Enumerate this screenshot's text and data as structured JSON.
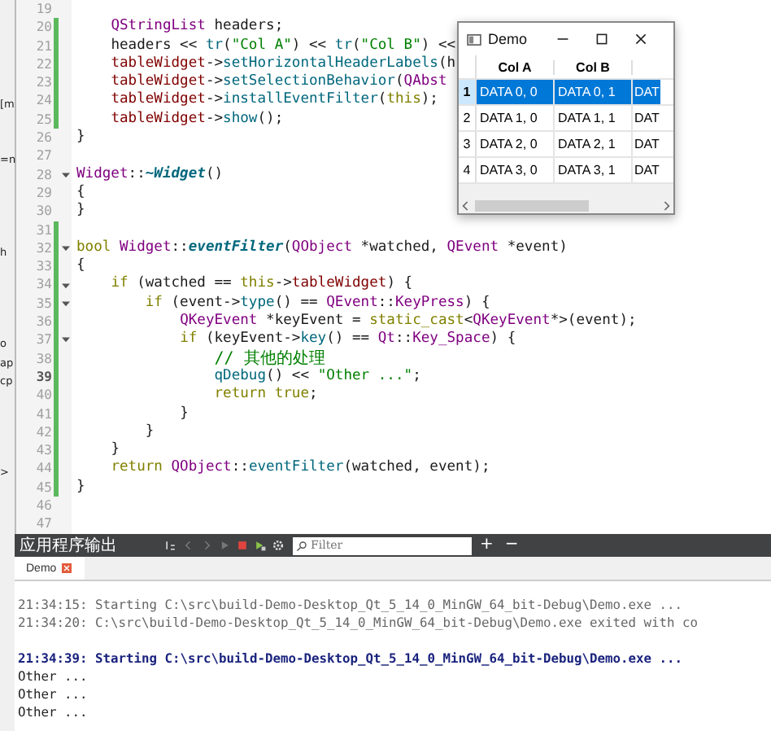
{
  "editor": {
    "lines": [
      {
        "number": "19",
        "changed": false,
        "fold": false,
        "current": false
      },
      {
        "number": "20",
        "changed": true,
        "fold": false,
        "current": false,
        "code": [
          {
            "kind": "type",
            "text": "    QStringList"
          },
          " headers;"
        ]
      },
      {
        "number": "21",
        "changed": true,
        "fold": false,
        "current": false,
        "code": [
          "    headers << ",
          {
            "kind": "fn",
            "text": "tr"
          },
          "(",
          {
            "kind": "str",
            "text": "\"Col A\""
          },
          ") << ",
          {
            "kind": "fn",
            "text": "tr"
          },
          "(",
          {
            "kind": "str",
            "text": "\"Col B\""
          },
          ") <<"
        ]
      },
      {
        "number": "22",
        "changed": true,
        "fold": false,
        "current": false,
        "code": [
          {
            "kind": "member",
            "text": "    tableWidget"
          },
          "->",
          {
            "kind": "fn",
            "text": "setHorizontalHeaderLabels"
          },
          "(h"
        ]
      },
      {
        "number": "23",
        "changed": true,
        "fold": false,
        "current": false,
        "code": [
          {
            "kind": "member",
            "text": "    tableWidget"
          },
          "->",
          {
            "kind": "fn",
            "text": "setSelectionBehavior"
          },
          "(",
          {
            "kind": "type",
            "text": "QAbst"
          }
        ]
      },
      {
        "number": "24",
        "changed": true,
        "fold": false,
        "current": false,
        "side": "[m",
        "code": [
          {
            "kind": "member",
            "text": "    tableWidget"
          },
          "->",
          {
            "kind": "fn",
            "text": "installEventFilter"
          },
          "(",
          {
            "kind": "kw",
            "text": "this"
          },
          ");"
        ]
      },
      {
        "number": "25",
        "changed": true,
        "fold": false,
        "current": false,
        "code": [
          {
            "kind": "member",
            "text": "    tableWidget"
          },
          "->",
          {
            "kind": "fn",
            "text": "show"
          },
          "();"
        ]
      },
      {
        "number": "26",
        "changed": false,
        "fold": false,
        "current": false,
        "code": [
          "}"
        ]
      },
      {
        "number": "27",
        "changed": false,
        "fold": false,
        "current": false,
        "side": "=n"
      },
      {
        "number": "28",
        "changed": false,
        "fold": true,
        "current": false,
        "code": [
          {
            "kind": "type",
            "text": "Widget"
          },
          "::",
          {
            "kind": "fnbi",
            "text": "~Widget"
          },
          "()"
        ]
      },
      {
        "number": "29",
        "changed": false,
        "fold": false,
        "current": false,
        "code": [
          "{"
        ]
      },
      {
        "number": "30",
        "changed": false,
        "fold": false,
        "current": false,
        "code": [
          "}"
        ]
      },
      {
        "number": "31",
        "changed": true,
        "fold": false,
        "current": false
      },
      {
        "number": "32",
        "changed": true,
        "fold": true,
        "current": false,
        "side": "h",
        "code": [
          {
            "kind": "kw",
            "text": "bool "
          },
          {
            "kind": "type",
            "text": "Widget"
          },
          "::",
          {
            "kind": "fnbi",
            "text": "eventFilter"
          },
          "(",
          {
            "kind": "type",
            "text": "QObject"
          },
          " *watched, ",
          {
            "kind": "type",
            "text": "QEvent"
          },
          " *event)"
        ]
      },
      {
        "number": "33",
        "changed": true,
        "fold": false,
        "current": false,
        "code": [
          "{"
        ]
      },
      {
        "number": "34",
        "changed": true,
        "fold": true,
        "current": false,
        "code": [
          {
            "kind": "kw",
            "text": "    if"
          },
          " (watched == ",
          {
            "kind": "kw",
            "text": "this"
          },
          "->",
          {
            "kind": "member",
            "text": "tableWidget"
          },
          ") {"
        ]
      },
      {
        "number": "35",
        "changed": true,
        "fold": true,
        "current": false,
        "code": [
          {
            "kind": "kw",
            "text": "        if"
          },
          " (event->",
          {
            "kind": "fn",
            "text": "type"
          },
          "() == ",
          {
            "kind": "type",
            "text": "QEvent"
          },
          "::",
          {
            "kind": "type",
            "text": "KeyPress"
          },
          ") {"
        ]
      },
      {
        "number": "36",
        "changed": true,
        "fold": false,
        "current": false,
        "code": [
          {
            "kind": "type",
            "text": "            QKeyEvent"
          },
          " *keyEvent = ",
          {
            "kind": "kw",
            "text": "static_cast"
          },
          "<",
          {
            "kind": "type",
            "text": "QKeyEvent"
          },
          "*>(event);"
        ]
      },
      {
        "number": "37",
        "changed": true,
        "fold": true,
        "current": false,
        "side": "o",
        "code": [
          {
            "kind": "kw",
            "text": "            if"
          },
          " (keyEvent->",
          {
            "kind": "fn",
            "text": "key"
          },
          "() == ",
          {
            "kind": "type",
            "text": "Qt"
          },
          "::",
          {
            "kind": "type",
            "text": "Key_Space"
          },
          ") {"
        ]
      },
      {
        "number": "38",
        "changed": true,
        "fold": false,
        "current": false,
        "side": "ap",
        "code": [
          {
            "kind": "comment",
            "text": "                // 其他的处理"
          }
        ]
      },
      {
        "number": "39",
        "changed": true,
        "fold": false,
        "current": true,
        "side": "cp",
        "code": [
          {
            "kind": "fn",
            "text": "                qDebug"
          },
          "() << ",
          {
            "kind": "str",
            "text": "\"Other ...\""
          },
          ";"
        ]
      },
      {
        "number": "40",
        "changed": true,
        "fold": false,
        "current": false,
        "code": [
          {
            "kind": "kw",
            "text": "                return true"
          },
          ";"
        ]
      },
      {
        "number": "41",
        "changed": true,
        "fold": false,
        "current": false,
        "code": [
          "            }"
        ]
      },
      {
        "number": "42",
        "changed": true,
        "fold": false,
        "current": false,
        "code": [
          "        }"
        ]
      },
      {
        "number": "43",
        "changed": true,
        "fold": false,
        "current": false,
        "code": [
          "    }"
        ]
      },
      {
        "number": "44",
        "changed": true,
        "fold": false,
        "current": false,
        "side": ">",
        "code": [
          {
            "kind": "kw",
            "text": "    return "
          },
          {
            "kind": "type",
            "text": "QObject"
          },
          "::",
          {
            "kind": "fn",
            "text": "eventFilter"
          },
          "(watched, event);"
        ]
      },
      {
        "number": "45",
        "changed": true,
        "fold": false,
        "current": false,
        "code": [
          "}"
        ]
      },
      {
        "number": "46",
        "changed": false,
        "fold": false,
        "current": false
      },
      {
        "number": "47",
        "changed": false,
        "fold": false,
        "current": false
      }
    ]
  },
  "demo_window": {
    "title": "Demo",
    "columns": [
      "Col A",
      "Col B"
    ],
    "rows": [
      {
        "number": "1",
        "selected": true,
        "cells": [
          "DATA 0, 0",
          "DATA 0, 1",
          "DAT"
        ]
      },
      {
        "number": "2",
        "selected": false,
        "cells": [
          "DATA 1, 0",
          "DATA 1, 1",
          "DAT"
        ]
      },
      {
        "number": "3",
        "selected": false,
        "cells": [
          "DATA 2, 0",
          "DATA 2, 1",
          "DAT"
        ]
      },
      {
        "number": "4",
        "selected": false,
        "cells": [
          "DATA 3, 0",
          "DATA 3, 1",
          "DAT"
        ]
      }
    ]
  },
  "output_panel": {
    "title": "应用程序输出",
    "filter": {
      "placeholder": "Filter"
    },
    "add": "+",
    "remove": "−",
    "tabs": [
      {
        "label": "Demo",
        "selected": true
      }
    ],
    "runs": [
      [
        {
          "kind": "info",
          "text": "21:34:15: Starting C:\\src\\build-Demo-Desktop_Qt_5_14_0_MinGW_64_bit-Debug\\Demo.exe ..."
        },
        {
          "kind": "info",
          "text": "21:34:20: C:\\src\\build-Demo-Desktop_Qt_5_14_0_MinGW_64_bit-Debug\\Demo.exe exited with co"
        }
      ],
      [
        {
          "kind": "start",
          "text": "21:34:39: Starting C:\\src\\build-Demo-Desktop_Qt_5_14_0_MinGW_64_bit-Debug\\Demo.exe ..."
        },
        {
          "kind": "stdout",
          "text": "Other ..."
        },
        {
          "kind": "stdout",
          "text": "Other ..."
        },
        {
          "kind": "stdout",
          "text": "Other ..."
        }
      ]
    ]
  }
}
